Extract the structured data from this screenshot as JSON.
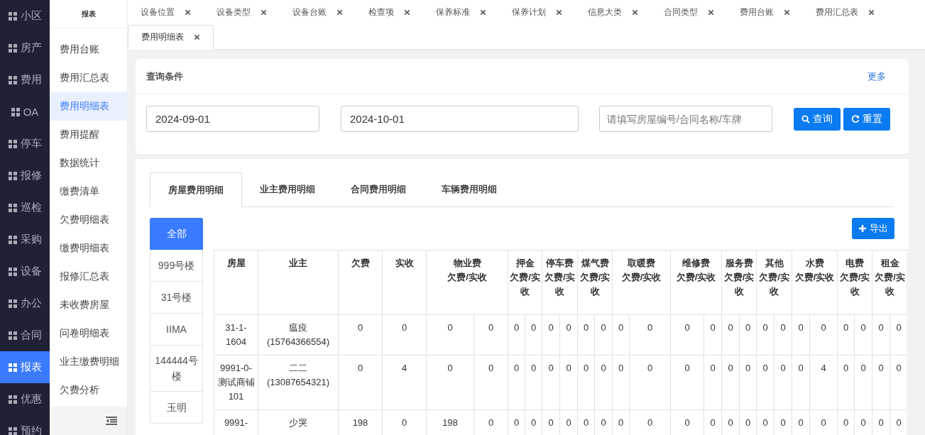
{
  "nav": {
    "items": [
      {
        "label": "小区",
        "selected": false
      },
      {
        "label": "房产",
        "selected": false
      },
      {
        "label": "费用",
        "selected": false
      },
      {
        "label": "OA",
        "selected": false
      },
      {
        "label": "停车",
        "selected": false
      },
      {
        "label": "报修",
        "selected": false
      },
      {
        "label": "巡检",
        "selected": false
      },
      {
        "label": "采购",
        "selected": false
      },
      {
        "label": "设备",
        "selected": false
      },
      {
        "label": "办公",
        "selected": false
      },
      {
        "label": "合同",
        "selected": false
      },
      {
        "label": "报表",
        "selected": true
      },
      {
        "label": "优惠",
        "selected": false
      },
      {
        "label": "预约",
        "selected": false
      }
    ]
  },
  "subnav": {
    "title": "报表",
    "items": [
      {
        "label": "费用台账",
        "selected": false
      },
      {
        "label": "费用汇总表",
        "selected": false
      },
      {
        "label": "费用明细表",
        "selected": true
      },
      {
        "label": "费用提醒",
        "selected": false
      },
      {
        "label": "数据统计",
        "selected": false
      },
      {
        "label": "缴费清单",
        "selected": false
      },
      {
        "label": "欠费明细表",
        "selected": false
      },
      {
        "label": "缴费明细表",
        "selected": false
      },
      {
        "label": "报修汇总表",
        "selected": false
      },
      {
        "label": "未收费房屋",
        "selected": false
      },
      {
        "label": "问卷明细表",
        "selected": false
      },
      {
        "label": "业主缴费明细",
        "selected": false
      },
      {
        "label": "欠费分析",
        "selected": false
      }
    ]
  },
  "page_tabs": [
    {
      "label": "设备位置",
      "selected": false
    },
    {
      "label": "设备类型",
      "selected": false
    },
    {
      "label": "设备台账",
      "selected": false
    },
    {
      "label": "检查项",
      "selected": false
    },
    {
      "label": "保养标准",
      "selected": false
    },
    {
      "label": "保养计划",
      "selected": false
    },
    {
      "label": "信息大类",
      "selected": false
    },
    {
      "label": "合同类型",
      "selected": false
    },
    {
      "label": "费用台账",
      "selected": false
    },
    {
      "label": "费用汇总表",
      "selected": false
    },
    {
      "label": "费用明细表",
      "selected": true
    }
  ],
  "query": {
    "title": "查询条件",
    "more": "更多",
    "start_date": "2024-09-01",
    "end_date": "2024-10-01",
    "search_placeholder": "请填写房屋编号/合同名称/车牌",
    "buttons": [
      {
        "kind": "search",
        "label": "查询"
      },
      {
        "kind": "reset",
        "label": "重置"
      }
    ]
  },
  "detail_tabs": [
    {
      "label": "房屋费用明细",
      "selected": true
    },
    {
      "label": "业主费用明细",
      "selected": false
    },
    {
      "label": "合同费用明细",
      "selected": false
    },
    {
      "label": "车辆费用明细",
      "selected": false
    }
  ],
  "buildings": [
    {
      "label": "全部",
      "selected": true
    },
    {
      "label": "999号楼",
      "selected": false
    },
    {
      "label": "31号楼",
      "selected": false
    },
    {
      "label": "IIMA",
      "selected": false
    },
    {
      "label": "144444号楼",
      "selected": false
    },
    {
      "label": "玉明",
      "selected": false
    }
  ],
  "export_button": "导出",
  "table": {
    "columns": [
      "房屋",
      "业主",
      "欠费",
      "实收"
    ],
    "fee_columns": [
      {
        "name": "物业费",
        "sub": "欠费/实收"
      },
      {
        "name": "押金",
        "sub": "欠费/实收"
      },
      {
        "name": "停车费",
        "sub": "欠费/实收"
      },
      {
        "name": "煤气费",
        "sub": "欠费/实收"
      },
      {
        "name": "取暖费",
        "sub": "欠费/实收"
      },
      {
        "name": "维修费",
        "sub": "欠费/实收"
      },
      {
        "name": "服务费",
        "sub": "欠费/实收"
      },
      {
        "name": "其他",
        "sub": "欠费/实收"
      },
      {
        "name": "水费",
        "sub": "欠费/实收"
      },
      {
        "name": "电费",
        "sub": "欠费/实收"
      },
      {
        "name": "租金",
        "sub": "欠费/实收"
      }
    ],
    "rows": [
      {
        "house": "31-1-1604",
        "owner": "瘟疫",
        "phone": "(15764366554)",
        "arrears": "0",
        "received": "0",
        "fees": [
          [
            "0",
            "0"
          ],
          [
            "0",
            "0"
          ],
          [
            "0",
            "0"
          ],
          [
            "0",
            "0"
          ],
          [
            "0",
            "0"
          ],
          [
            "0",
            "0"
          ],
          [
            "0",
            "0"
          ],
          [
            "0",
            "0"
          ],
          [
            "0",
            "0"
          ],
          [
            "0",
            "0"
          ],
          [
            "0",
            "0"
          ]
        ]
      },
      {
        "house": "9991-0-测试商铺101",
        "owner": "二二",
        "phone": "(13087654321)",
        "arrears": "0",
        "received": "4",
        "fees": [
          [
            "0",
            "0"
          ],
          [
            "0",
            "0"
          ],
          [
            "0",
            "0"
          ],
          [
            "0",
            "0"
          ],
          [
            "0",
            "0"
          ],
          [
            "0",
            "0"
          ],
          [
            "0",
            "0"
          ],
          [
            "0",
            "0"
          ],
          [
            "0",
            "4"
          ],
          [
            "0",
            "0"
          ],
          [
            "0",
            "0"
          ]
        ]
      },
      {
        "house": "9991-",
        "owner": "少哭",
        "phone": "",
        "arrears": "198",
        "received": "0",
        "fees": [
          [
            "198",
            "0"
          ],
          [
            "0",
            "0"
          ],
          [
            "0",
            "0"
          ],
          [
            "0",
            "0"
          ],
          [
            "0",
            "0"
          ],
          [
            "0",
            "0"
          ],
          [
            "0",
            "0"
          ],
          [
            "0",
            "0"
          ],
          [
            "0",
            "0"
          ],
          [
            "0",
            "0"
          ],
          [
            "0",
            "0"
          ]
        ]
      }
    ]
  }
}
